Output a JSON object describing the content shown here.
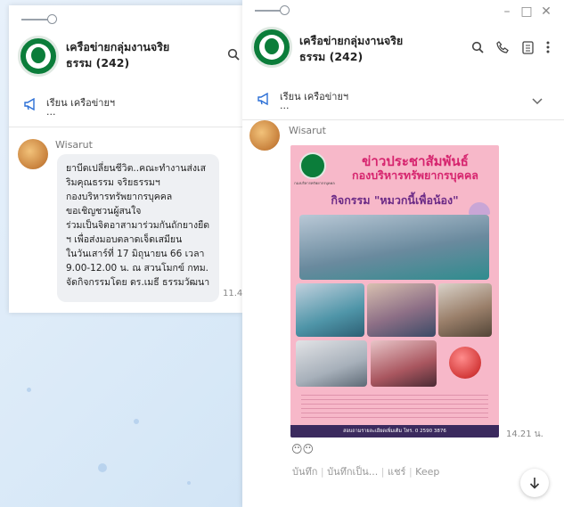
{
  "left_chat": {
    "group_title_line1": "เครือข่ายกลุ่มงานจริย",
    "group_title_line2": "ธรรม (242)",
    "announcement_title": "เรียน  เครือข่ายฯ",
    "announcement_more": "...",
    "sender": "Wisarut",
    "message_lines": [
      "ยาบีดเปลี่ยนชีวิต..คณะทำงานส่งเส",
      "ริมคุณธรรม จริยธรรมฯ",
      "กองบริหารทรัพยากรบุคคล",
      "ขอเชิญชวนผู้สนใจ",
      "ร่วมเป็นจิตอาสามาร่วมกันถักยางยืด",
      "ฯ เพื่อส่งมอบตลาดเจ็ดเสมียน",
      "ในวันเสาร์ที่ 17 มิถุนายน 66 เวลา",
      "9.00-12.00 น. ณ สวนโมกข์ กทม.",
      "จัดกิจกรรมโดย ดร.เมธี ธรรมวัฒนา"
    ],
    "time": "11.4"
  },
  "right_chat": {
    "group_title_line1": "เครือข่ายกลุ่มงานจริย",
    "group_title_line2": "ธรรม (242)",
    "window_controls": [
      "–",
      "□",
      "✕"
    ],
    "announcement_title": "เรียน  เครือข่ายฯ",
    "announcement_more": "...",
    "sender": "Wisarut",
    "poster": {
      "logo_caption": "กองบริหารทรัพยากรบุคคล",
      "heading_line1": "ข่าวประชาสัมพันธ์",
      "heading_line2": "กองบริหารทรัพยากรบุคคล",
      "activity": "กิจกรรม \"หมวกนี้เพื่อน้อง\"",
      "phone": "สอบถามรายละเอียดเพิ่มเติม โทร. 0 2590 3876"
    },
    "time": "14.21 น.",
    "reactions": "😶😶",
    "footer_links": [
      "บันทึก",
      "บันทึกเป็น...",
      "แชร์",
      "Keep"
    ]
  },
  "colors": {
    "brand_green": "#0b7d3a",
    "poster_pink": "#f7b8c9",
    "title_red": "#d6246e",
    "bubble": "#eef0f3"
  }
}
